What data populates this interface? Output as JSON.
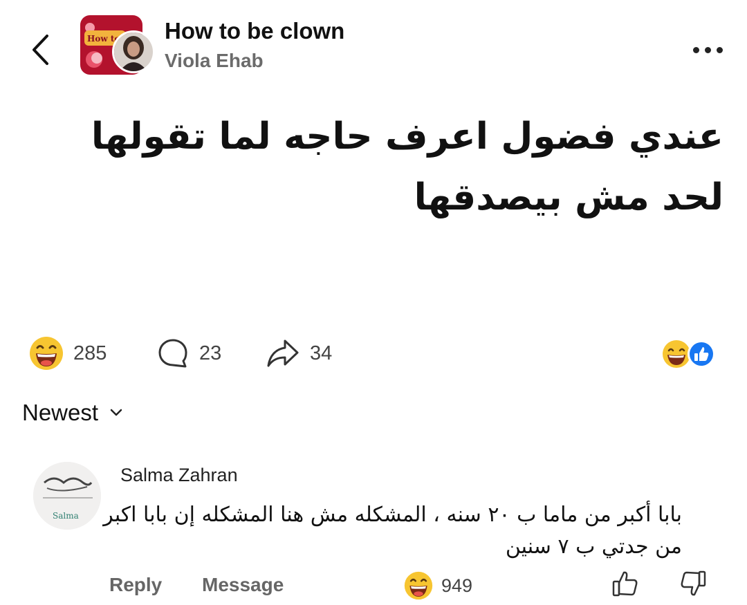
{
  "header": {
    "group_name": "How to be clown",
    "author_name": "Viola Ehab",
    "group_thumb_text": "How to be Clown"
  },
  "post": {
    "text": "عندي فضول اعرف حاجه لما تقولها لحد مش بيصدقها"
  },
  "actions": {
    "reactions_count": "285",
    "comments_count": "23",
    "shares_count": "34"
  },
  "sort": {
    "label": "Newest"
  },
  "comment": {
    "author": "Salma Zahran",
    "avatar_text": "Salma",
    "text": "بابا أكبر من ماما ب ٢٠ سنه ، المشكله مش هنا المشكله إن بابا اكبر من جدتي ب ٧ سنين",
    "reply_label": "Reply",
    "message_label": "Message",
    "reactions_count": "949"
  },
  "colors": {
    "emoji_yellow": "#f7c531",
    "like_blue": "#1877f2",
    "thumb_red": "#b3122d",
    "muted_text": "#6b6b6b"
  }
}
